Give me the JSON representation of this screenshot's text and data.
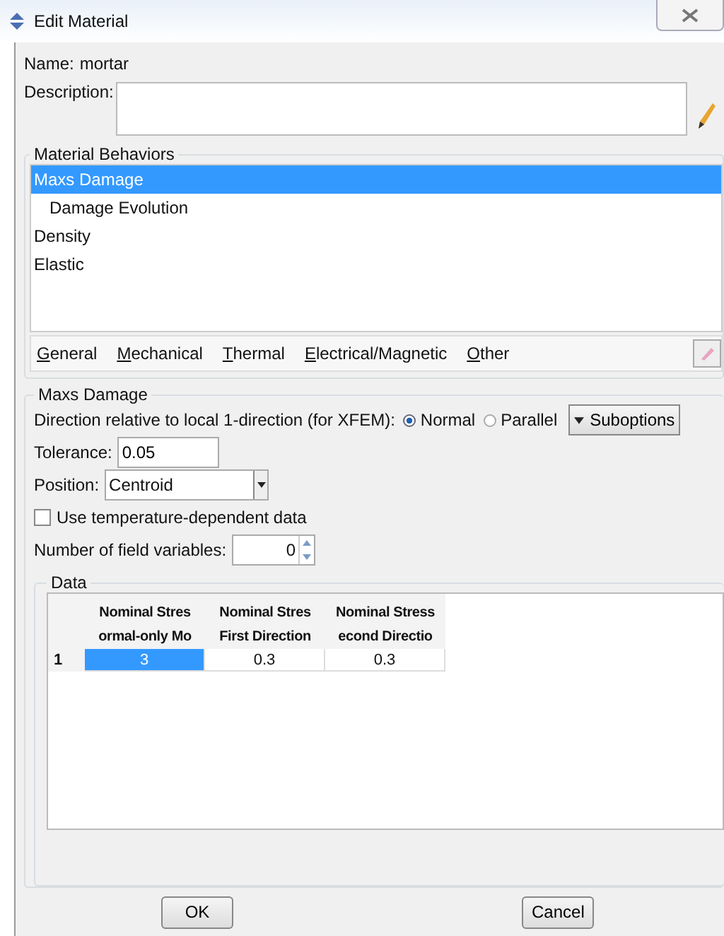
{
  "window": {
    "title": "Edit Material"
  },
  "name": {
    "label": "Name:",
    "value": "mortar"
  },
  "description": {
    "label": "Description:"
  },
  "material_behaviors": {
    "title": "Material Behaviors",
    "items": [
      {
        "label": "Maxs Damage",
        "selected": true,
        "children": [
          {
            "label": "Damage Evolution",
            "selected": false
          }
        ]
      },
      {
        "label": "Density",
        "selected": false
      },
      {
        "label": "Elastic",
        "selected": false
      }
    ],
    "menus": [
      "General",
      "Mechanical",
      "Thermal",
      "Electrical/Magnetic",
      "Other"
    ]
  },
  "section": {
    "title": "Maxs Damage",
    "direction": {
      "label": "Direction relative to local 1-direction (for XFEM):",
      "options": [
        {
          "label": "Normal",
          "selected": true
        },
        {
          "label": "Parallel",
          "selected": false
        }
      ]
    },
    "suboptions_button": "Suboptions",
    "tolerance": {
      "label": "Tolerance:",
      "value": "0.05"
    },
    "position": {
      "label": "Position:",
      "value": "Centroid"
    },
    "temperature_dependent": {
      "label": "Use temperature-dependent data",
      "checked": false
    },
    "field_variables": {
      "label": "Number of field variables:",
      "value": "0"
    }
  },
  "data": {
    "title": "Data",
    "columns": [
      {
        "line_1": "Nominal Stres",
        "line_2": "ormal-only Mo"
      },
      {
        "line_1": "Nominal Stres",
        "line_2": "First Direction"
      },
      {
        "line_1": "Nominal Stress",
        "line_2": "econd Directio"
      }
    ],
    "rows": [
      {
        "number": "1",
        "cells": [
          {
            "value": "3",
            "selected": true
          },
          {
            "value": "0.3",
            "selected": false
          },
          {
            "value": "0.3",
            "selected": false
          }
        ]
      }
    ]
  },
  "buttons": [
    "OK",
    "Cancel"
  ]
}
